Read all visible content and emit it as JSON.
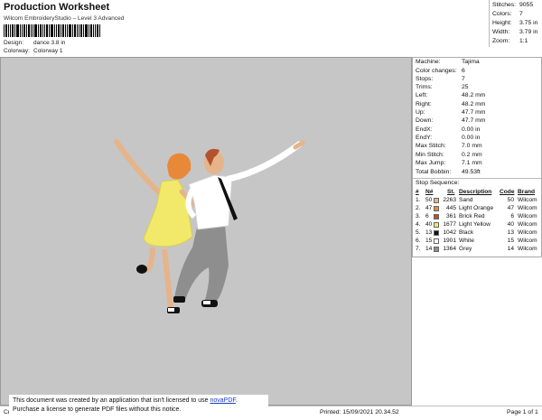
{
  "header": {
    "title": "Production Worksheet",
    "subtitle": "Wilcom EmbroideryStudio – Level 3 Advanced",
    "design_label": "Design:",
    "design_value": "dance 3.8 in",
    "colorway_label": "Colorway:",
    "colorway_value": "Colorway 1"
  },
  "summary": [
    {
      "label": "Stitches:",
      "value": "9055"
    },
    {
      "label": "Colors:",
      "value": "7"
    },
    {
      "label": "Height:",
      "value": "3.75 in"
    },
    {
      "label": "Width:",
      "value": "3.79 in"
    },
    {
      "label": "Zoom:",
      "value": "1:1"
    }
  ],
  "machine_info": [
    {
      "label": "Machine:",
      "value": "Tajima"
    },
    {
      "label": "Color changes:",
      "value": "6"
    },
    {
      "label": "Stops:",
      "value": "7"
    },
    {
      "label": "Trims:",
      "value": "25"
    },
    {
      "label": "Left:",
      "value": "48.2 mm"
    },
    {
      "label": "Right:",
      "value": "48.2 mm"
    },
    {
      "label": "Up:",
      "value": "47.7 mm"
    },
    {
      "label": "Down:",
      "value": "47.7 mm"
    },
    {
      "label": "EndX:",
      "value": "0.00 in"
    },
    {
      "label": "EndY:",
      "value": "0.00 in"
    },
    {
      "label": "Max Stitch:",
      "value": "7.0 mm"
    },
    {
      "label": "Min Stitch:",
      "value": "0.2 mm"
    },
    {
      "label": "Max Jump:",
      "value": "7.1 mm"
    },
    {
      "label": "Total Bobbin:",
      "value": "49.53ft"
    }
  ],
  "stop_sequence": {
    "title": "Stop Sequence:",
    "headers": [
      "#",
      "N#",
      "St.",
      "Description",
      "Code",
      "Brand"
    ],
    "rows": [
      {
        "num": "1.",
        "n": "50",
        "st": "2263",
        "color": "#e6b48a",
        "desc": "Sand",
        "code": "50",
        "brand": "Wilcom"
      },
      {
        "num": "2.",
        "n": "47",
        "st": "445",
        "color": "#e8893a",
        "desc": "Light Orange",
        "code": "47",
        "brand": "Wilcom"
      },
      {
        "num": "3.",
        "n": "6",
        "st": "361",
        "color": "#b4522e",
        "desc": "Brick Red",
        "code": "6",
        "brand": "Wilcom"
      },
      {
        "num": "4.",
        "n": "40",
        "st": "1677",
        "color": "#f2e96a",
        "desc": "Light Yellow",
        "code": "40",
        "brand": "Wilcom"
      },
      {
        "num": "5.",
        "n": "13",
        "st": "1042",
        "color": "#111111",
        "desc": "Black",
        "code": "13",
        "brand": "Wilcom"
      },
      {
        "num": "6.",
        "n": "15",
        "st": "1901",
        "color": "#ffffff",
        "desc": "White",
        "code": "15",
        "brand": "Wilcom"
      },
      {
        "num": "7.",
        "n": "14",
        "st": "1364",
        "color": "#8e8e8e",
        "desc": "Grey",
        "code": "14",
        "brand": "Wilcom"
      }
    ]
  },
  "footer": {
    "left": "Cr",
    "printed": "Printed: 15/09/2021 20.34.52",
    "page": "Page 1 of 1",
    "notice_line1_pre": "This document was created by an application that isn't licensed to use ",
    "notice_link": "novaPDF",
    "notice_line1_post": ".",
    "notice_line2": "Purchase a license to generate PDF files without this notice."
  }
}
